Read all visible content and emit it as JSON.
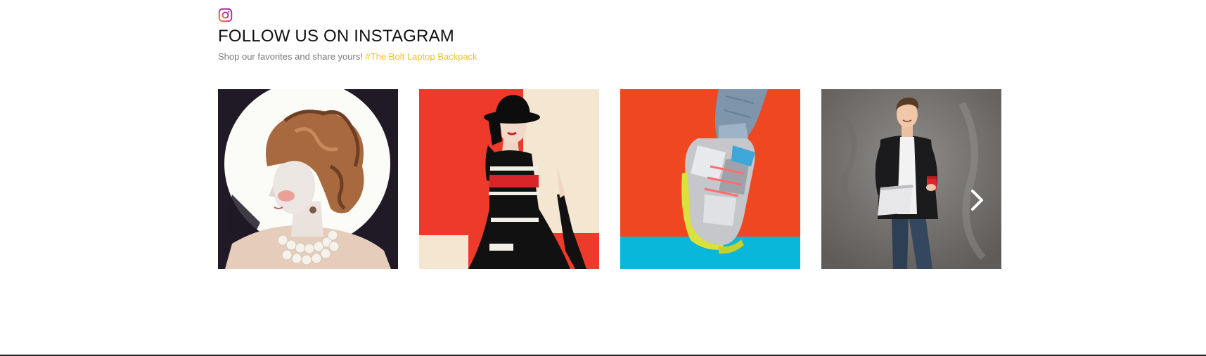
{
  "header": {
    "icon": "instagram-icon",
    "title": "FOLLOW US ON INSTAGRAM",
    "subtitle_text": "Shop our favorites and share yours! ",
    "hashtag": "#The Bolt Laptop Backpack"
  },
  "gallery": {
    "posts": [
      {
        "image": "woman-curly-updo-pearl-necklace-profile-photo"
      },
      {
        "image": "woman-black-hat-striped-dress-red-background-photo"
      },
      {
        "image": "metallic-sneaker-red-blue-background-photo"
      },
      {
        "image": "man-blazer-laptop-red-cup-gray-wall-photo"
      }
    ],
    "next_icon": "chevron-right-icon"
  },
  "colors": {
    "hashtag": "#f2be28",
    "title": "#111111",
    "subtitle": "#7b7b7b"
  }
}
